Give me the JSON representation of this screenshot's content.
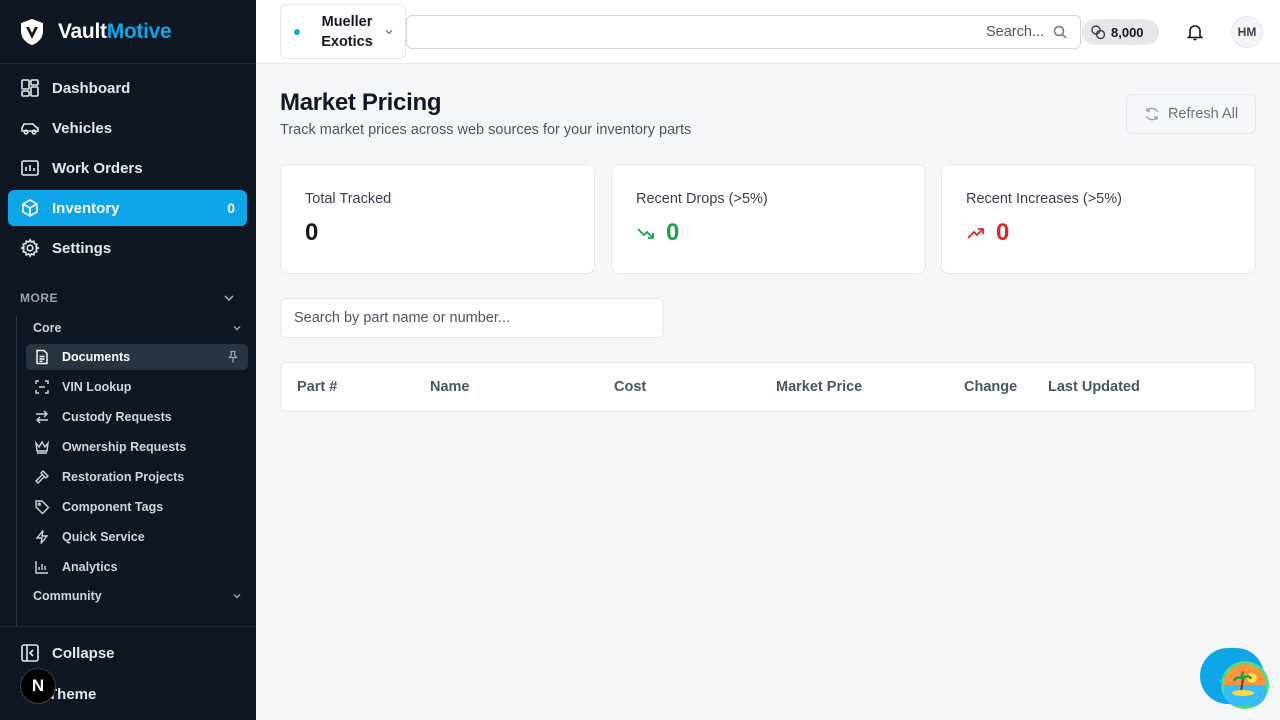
{
  "brand": {
    "part1": "Vault",
    "part2": "Motive"
  },
  "nav": [
    {
      "label": "Dashboard",
      "icon": "dashboard-icon"
    },
    {
      "label": "Vehicles",
      "icon": "car-icon"
    },
    {
      "label": "Work Orders",
      "icon": "work-orders-icon"
    },
    {
      "label": "Inventory",
      "icon": "box-icon",
      "count": "0",
      "active": true
    },
    {
      "label": "Settings",
      "icon": "gear-icon"
    }
  ],
  "more": {
    "label": "MORE",
    "core_label": "Core",
    "items": [
      {
        "label": "Documents",
        "icon": "document-icon",
        "active": true
      },
      {
        "label": "VIN Lookup",
        "icon": "scan-icon"
      },
      {
        "label": "Custody Requests",
        "icon": "arrows-swap-icon"
      },
      {
        "label": "Ownership Requests",
        "icon": "crown-icon"
      },
      {
        "label": "Restoration Projects",
        "icon": "hammer-icon"
      },
      {
        "label": "Component Tags",
        "icon": "tag-icon"
      },
      {
        "label": "Quick Service",
        "icon": "bolt-icon"
      },
      {
        "label": "Analytics",
        "icon": "bar-chart-icon"
      }
    ],
    "community_label": "Community"
  },
  "bottom": {
    "collapse_label": "Collapse",
    "theme_label": "Theme",
    "badge": "N"
  },
  "topbar": {
    "org_name": "Mueller Exotics",
    "search_placeholder": "Search...",
    "credits": "8,000",
    "avatar_initials": "HM"
  },
  "page": {
    "title": "Market Pricing",
    "subtitle": "Track market prices across web sources for your inventory parts",
    "refresh_label": "Refresh All"
  },
  "stats": [
    {
      "label": "Total Tracked",
      "value": "0"
    },
    {
      "label": "Recent Drops (>5%)",
      "value": "0"
    },
    {
      "label": "Recent Increases (>5%)",
      "value": "0"
    }
  ],
  "part_search_placeholder": "Search by part name or number...",
  "table": {
    "columns": [
      "Part #",
      "Name",
      "Cost",
      "Market Price",
      "Change",
      "Last Updated"
    ]
  },
  "colors": {
    "accent": "#0ea5e9",
    "sidebar_bg": "#0f1723",
    "drop": "#16a34a",
    "increase": "#dc2626"
  }
}
